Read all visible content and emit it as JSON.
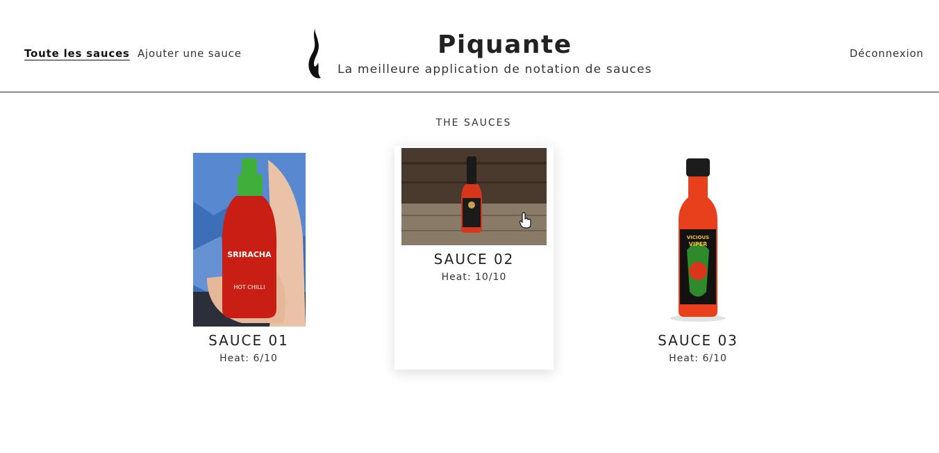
{
  "nav": {
    "all_sauces": "Toute les sauces",
    "add_sauce": "Ajouter une sauce",
    "logout": "Déconnexion"
  },
  "brand": {
    "title": "Piquante",
    "tagline": "La meilleure application de notation de sauces",
    "logo_icon": "flame-icon"
  },
  "section": {
    "title": "THE SAUCES"
  },
  "sauces": [
    {
      "name": "SAUCE 01",
      "heat": "Heat: 6/10",
      "bottle_label": "SRIRACHA SAUCE",
      "bottle_color": "#c81e14",
      "cap_color": "#3fae3a"
    },
    {
      "name": "SAUCE 02",
      "heat": "Heat: 10/10",
      "bottle_color": "#d8361a",
      "cap_color": "#1a1a1a"
    },
    {
      "name": "SAUCE 03",
      "heat": "Heat: 6/10",
      "bottle_label": "VICIOUS VIPER",
      "bottle_color": "#e8401c",
      "cap_color": "#1c1c1c"
    }
  ],
  "colors": {
    "accent": "#222222",
    "background": "#ffffff"
  }
}
